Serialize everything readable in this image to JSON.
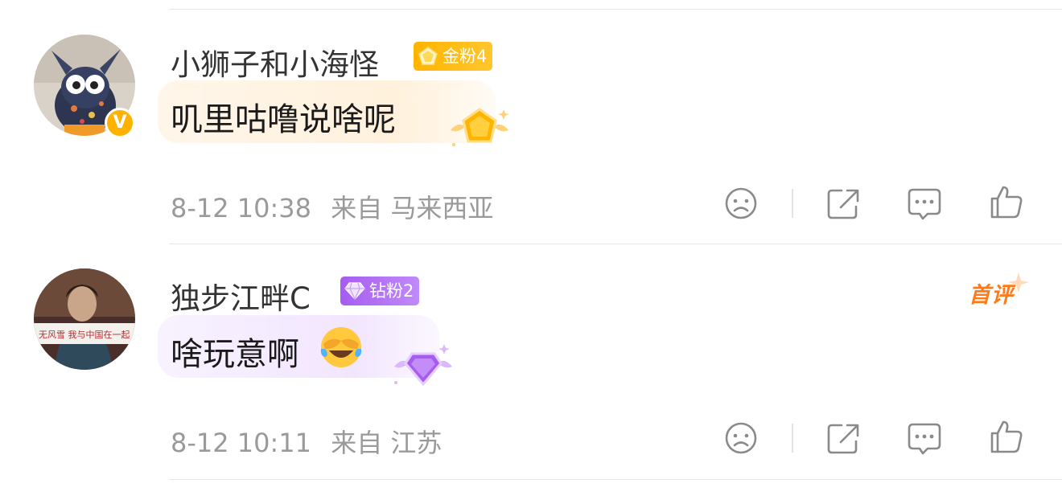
{
  "comments": [
    {
      "username": "小狮子和小海怪",
      "fan_badge": {
        "label": "金粉4",
        "tier": "gold",
        "color": "#ffb400"
      },
      "verified": true,
      "verified_mark": "V",
      "text": "叽里咕噜说啥呢",
      "time": "8-12 10:38",
      "location": "来自 马来西亚",
      "is_first": false
    },
    {
      "username": "独步江畔C",
      "fan_badge": {
        "label": "钻粉2",
        "tier": "diamond",
        "color": "#a65cf0"
      },
      "verified": false,
      "text": "啥玩意啊",
      "emoji": "face-with-tears-of-joy-covering-eyes",
      "time": "8-12 10:11",
      "location": "来自 江苏",
      "is_first": true,
      "first_tag": "首评"
    }
  ],
  "actions": [
    "dislike-icon",
    "share-icon",
    "comment-icon",
    "like-icon"
  ],
  "colors": {
    "meta": "#9a9a9a",
    "accent_first": "#ff7a1a",
    "divider": "#e6e6e6"
  }
}
